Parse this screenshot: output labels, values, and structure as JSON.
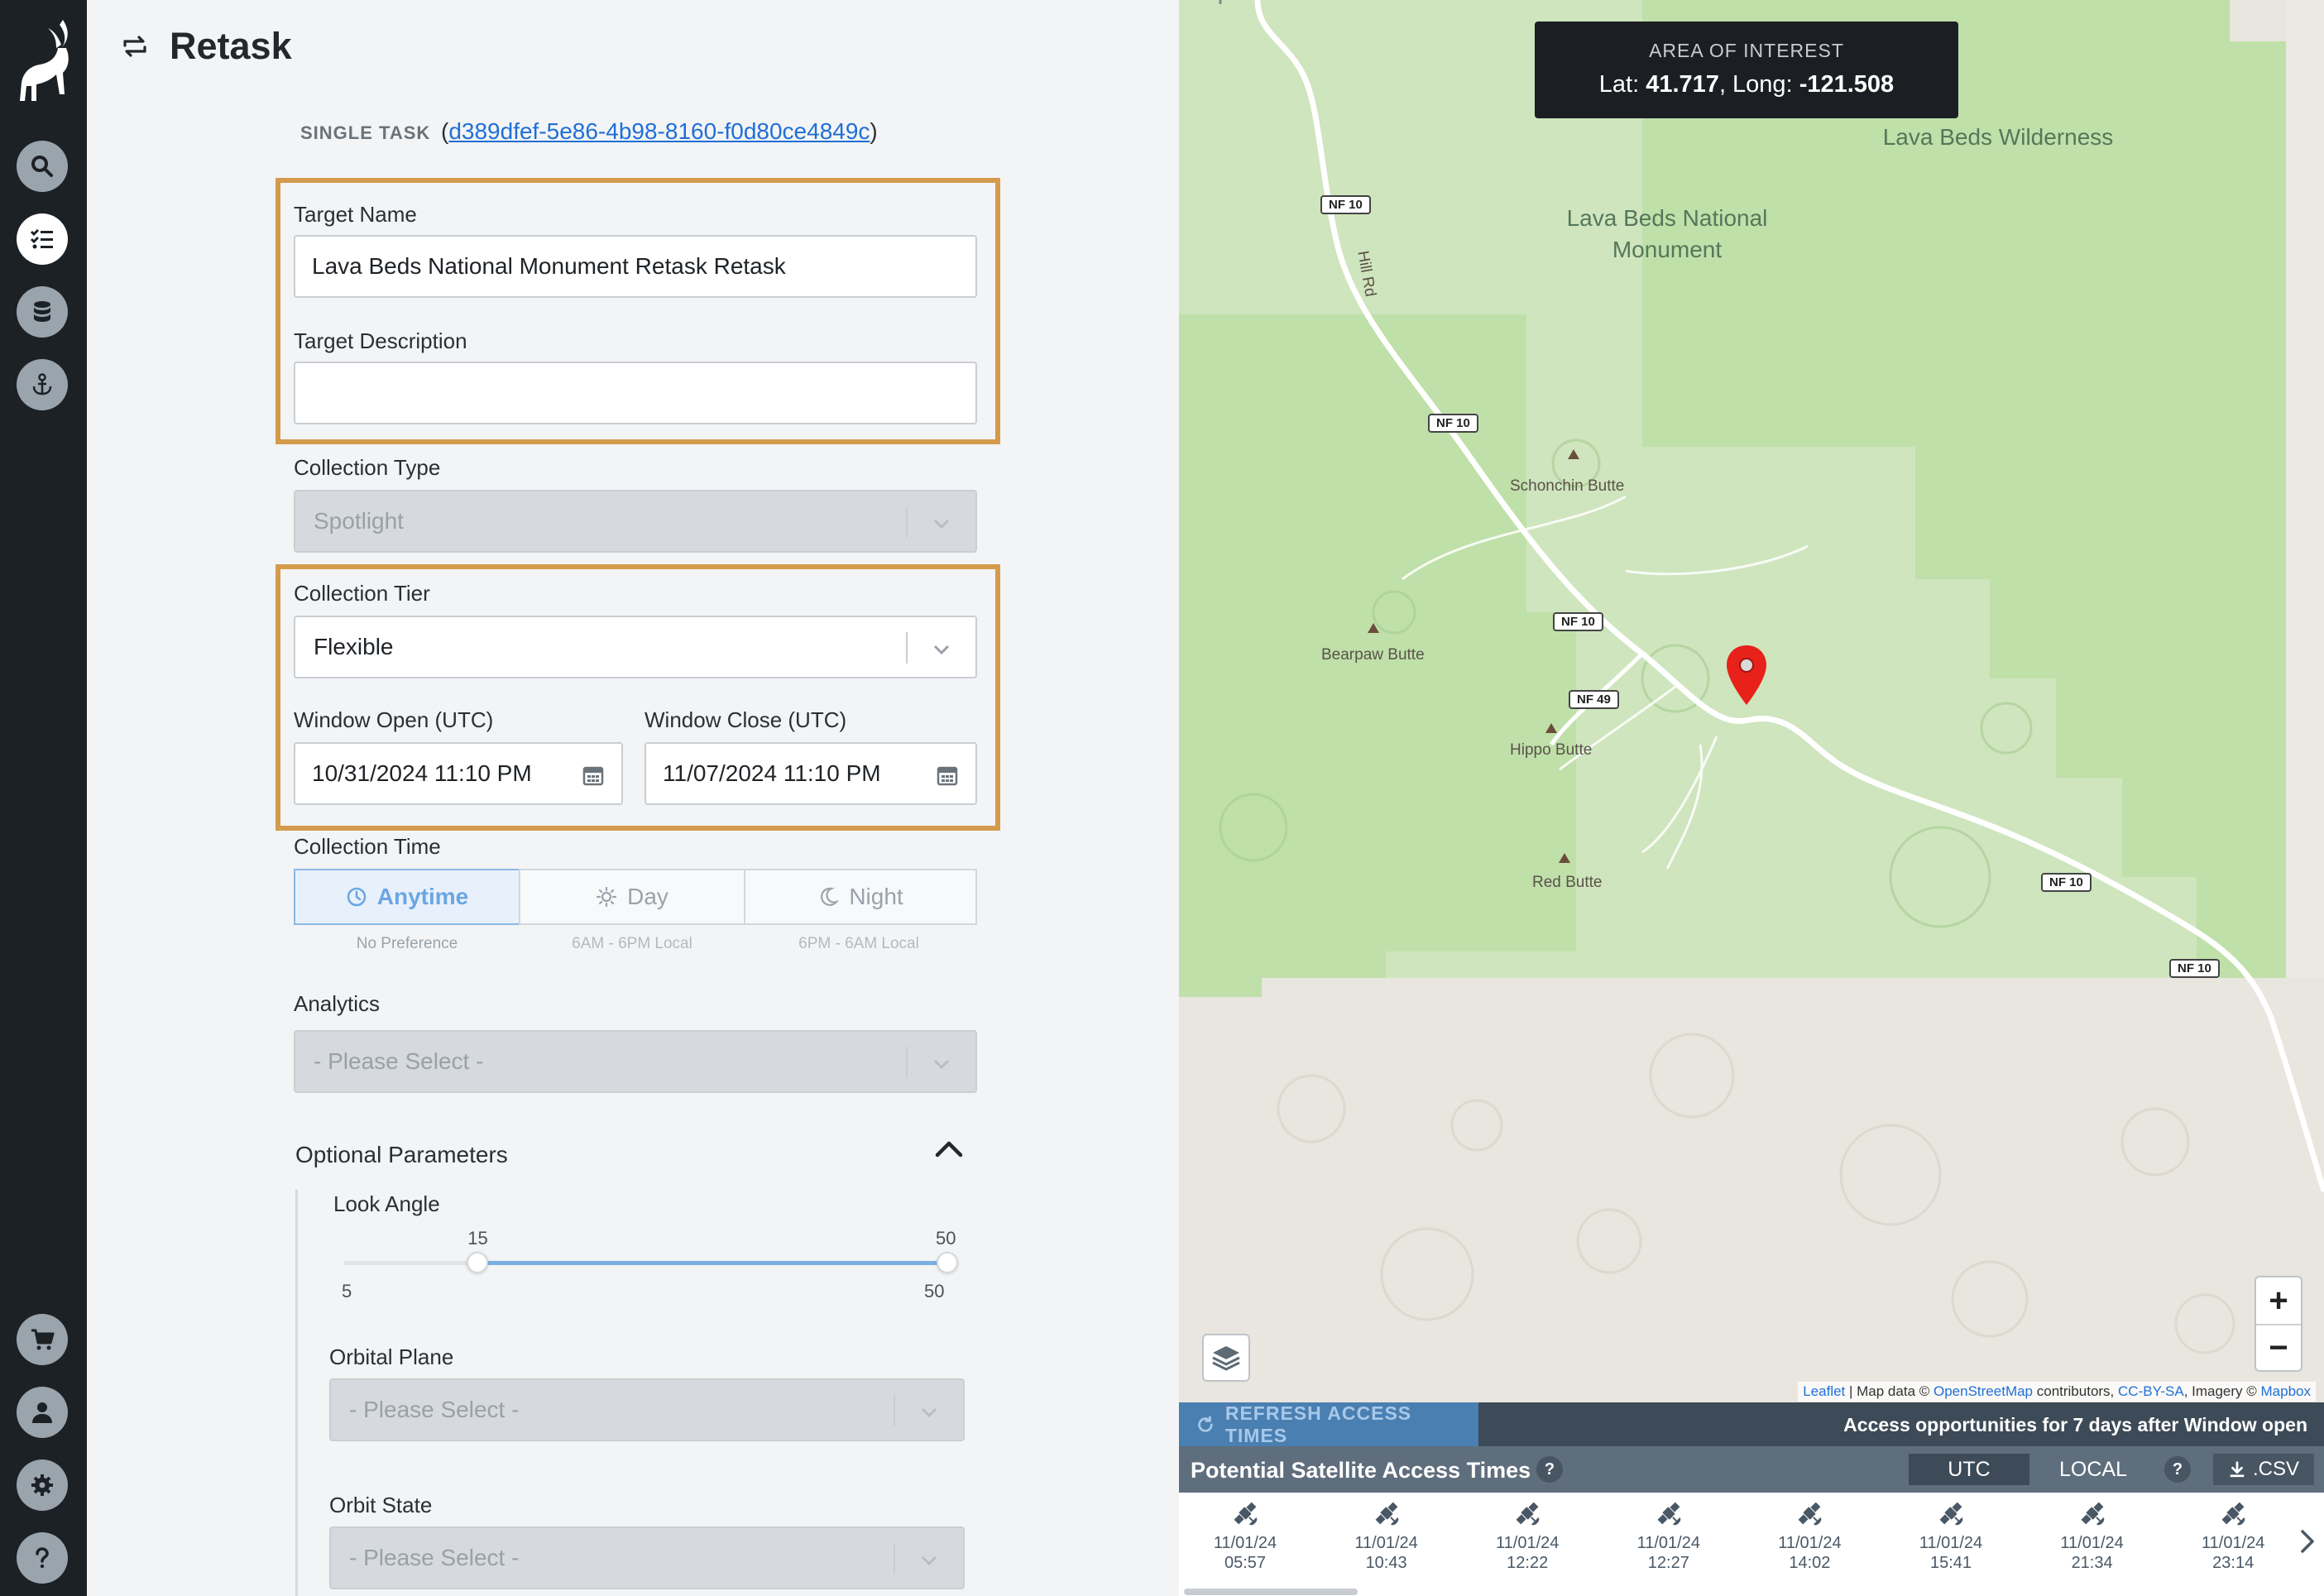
{
  "page": {
    "title": "Retask",
    "single_task_label": "SINGLE TASK",
    "task_id": "d389dfef-5e86-4b98-8160-f0d80ce4849c",
    "paren_open": "(",
    "paren_close": ")"
  },
  "nav": {
    "top_icons": [
      "search-icon",
      "task-list-icon",
      "database-icon",
      "anchor-icon"
    ],
    "bottom_icons": [
      "cart-icon",
      "user-icon",
      "settings-icon",
      "help-icon"
    ],
    "active": "task-list-icon"
  },
  "form": {
    "target_name": {
      "label": "Target Name",
      "value": "Lava Beds National Monument Retask Retask"
    },
    "target_description": {
      "label": "Target Description",
      "value": ""
    },
    "collection_type": {
      "label": "Collection Type",
      "value": "Spotlight"
    },
    "collection_tier": {
      "label": "Collection Tier",
      "value": "Flexible"
    },
    "window_open": {
      "label": "Window Open (UTC)",
      "value": "10/31/2024 11:10 PM"
    },
    "window_close": {
      "label": "Window Close (UTC)",
      "value": "11/07/2024 11:10 PM"
    },
    "collection_time": {
      "label": "Collection Time",
      "options": [
        {
          "label": "Anytime",
          "sub": "No Preference",
          "icon": "clock-icon"
        },
        {
          "label": "Day",
          "sub": "6AM - 6PM Local",
          "icon": "sun-icon"
        },
        {
          "label": "Night",
          "sub": "6PM - 6AM Local",
          "icon": "moon-icon"
        }
      ],
      "selected": "Anytime"
    },
    "analytics": {
      "label": "Analytics",
      "placeholder": "- Please Select -"
    },
    "optional_parameters": {
      "label": "Optional Parameters",
      "look_angle": {
        "label": "Look Angle",
        "min": 5,
        "max": 50,
        "low": 15,
        "high": 50,
        "min_label": "5",
        "max_label": "50",
        "low_label": "15",
        "high_label": "50"
      },
      "orbital_plane": {
        "label": "Orbital Plane",
        "placeholder": "- Please Select -"
      },
      "orbit_state": {
        "label": "Orbit State",
        "placeholder": "- Please Select -"
      }
    }
  },
  "map": {
    "aoi": {
      "title": "AREA OF INTEREST",
      "lat_label": "Lat: ",
      "lat": "41.717",
      "long_label": ", Long: ",
      "long": "-121.508"
    },
    "labels": {
      "wilderness": "Lava Beds Wilderness",
      "monument_line1": "Lava Beds National",
      "monument_line2": "Monument",
      "schonchin": "Schonchin Butte",
      "bearpaw": "Bearpaw Butte",
      "hippo": "Hippo Butte",
      "red": "Red Butte",
      "hill_rd": "Hill Rd"
    },
    "shields": {
      "nf10": "NF 10",
      "nf49": "NF 49"
    },
    "zoom_in": "+",
    "zoom_out": "−",
    "attribution": {
      "leaflet": "Leaflet",
      "sep1": " | Map data © ",
      "osm": "OpenStreetMap",
      "mid": " contributors, ",
      "cc": "CC-BY-SA",
      "imagery": ", Imagery © ",
      "mapbox": "Mapbox"
    },
    "colors": {
      "green": "#cfe5bd",
      "green_dark": "#bfe0a9",
      "land": "#e9e5df",
      "marker": "#e8211a"
    }
  },
  "access": {
    "refresh_label": "REFRESH ACCESS TIMES",
    "note": "Access opportunities for 7 days after Window open",
    "title": "Potential Satellite Access Times",
    "help": "?",
    "utc": "UTC",
    "local": "LOCAL",
    "csv": ".CSV",
    "items": [
      {
        "date": "11/01/24",
        "time": "05:57"
      },
      {
        "date": "11/01/24",
        "time": "10:43"
      },
      {
        "date": "11/01/24",
        "time": "12:22"
      },
      {
        "date": "11/01/24",
        "time": "12:27"
      },
      {
        "date": "11/01/24",
        "time": "14:02"
      },
      {
        "date": "11/01/24",
        "time": "15:41"
      },
      {
        "date": "11/01/24",
        "time": "21:34"
      },
      {
        "date": "11/01/24",
        "time": "23:14"
      }
    ]
  }
}
